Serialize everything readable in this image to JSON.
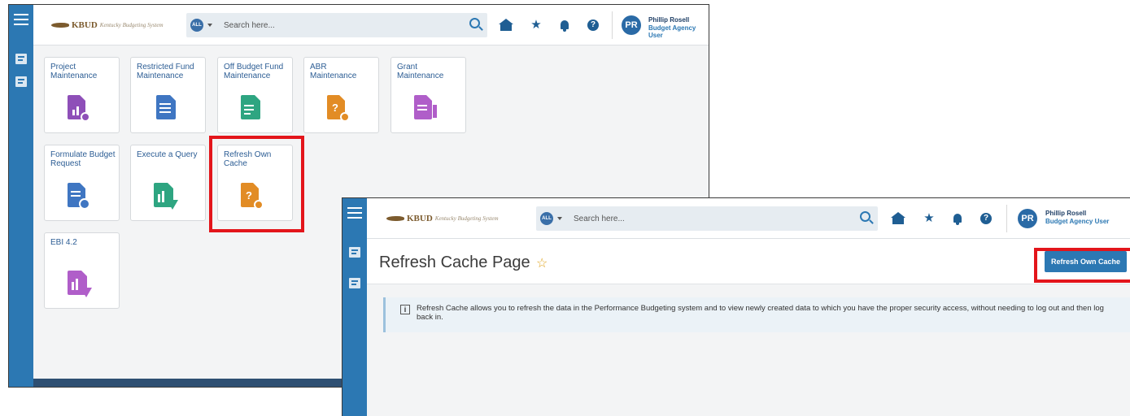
{
  "app": {
    "logo_brand": "KBUD",
    "logo_sub": "Kentucky Budgeting System",
    "search_scope": "ALL",
    "search_placeholder": "Search here...",
    "user_initials": "PR",
    "user_name": "Phillip Rosell",
    "user_role": "Budget Agency User"
  },
  "dashboard": {
    "tiles": [
      {
        "label": "Project Maintenance",
        "icon": "project-maintenance-icon",
        "color": "#8e4fb8"
      },
      {
        "label": "Restricted Fund Maintenance",
        "icon": "restricted-fund-icon",
        "color": "#3f76c2"
      },
      {
        "label": "Off Budget Fund Maintenance",
        "icon": "off-budget-fund-icon",
        "color": "#2ea581"
      },
      {
        "label": "ABR Maintenance",
        "icon": "abr-maintenance-icon",
        "color": "#e28c25"
      },
      {
        "label": "Grant Maintenance",
        "icon": "grant-maintenance-icon",
        "color": "#b05ec9"
      },
      {
        "label": "Formulate Budget Request",
        "icon": "formulate-budget-icon",
        "color": "#3f76c2"
      },
      {
        "label": "Execute a Query",
        "icon": "execute-query-icon",
        "color": "#2ea581"
      },
      {
        "label": "Refresh Own Cache",
        "icon": "refresh-cache-icon",
        "color": "#e28c25"
      },
      {
        "label": "EBI 4.2",
        "icon": "ebi-report-icon",
        "color": "#b05ec9"
      }
    ]
  },
  "refresh_page": {
    "title": "Refresh Cache Page",
    "button_label": "Refresh Own Cache",
    "info_text": "Refresh Cache allows you to refresh the data in the Performance Budgeting system and to view newly created data to which you have the proper security access, without needing to log out and then log back in."
  },
  "colors": {
    "rail": "#2c78b3",
    "highlight": "#e3151b",
    "primary_button": "#2c78b3"
  }
}
